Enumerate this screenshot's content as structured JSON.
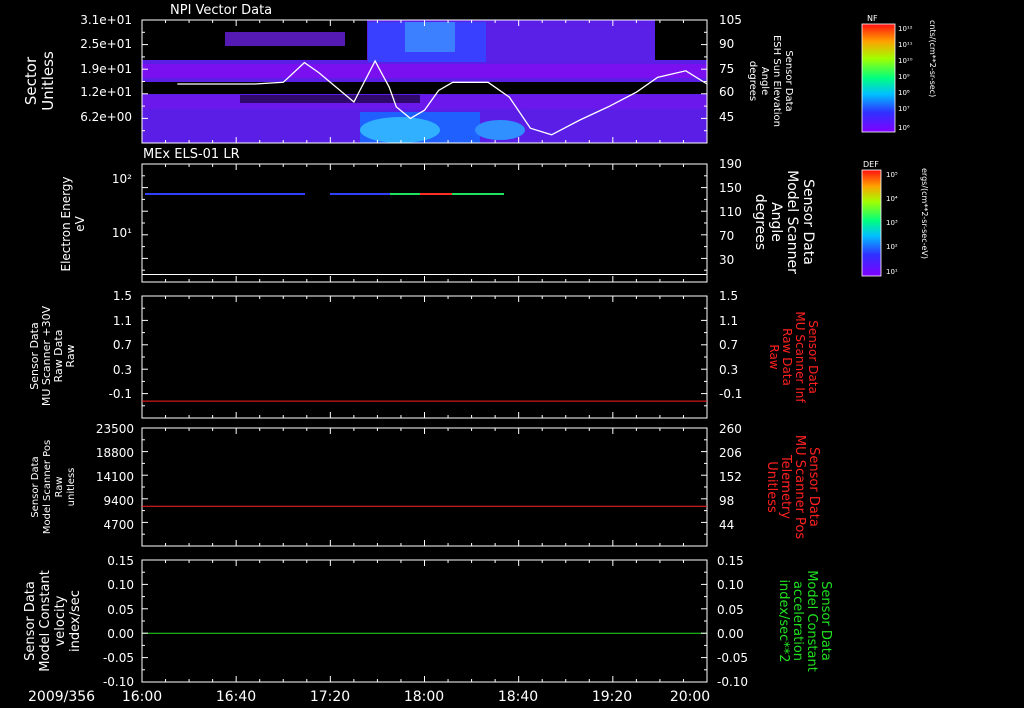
{
  "date_label": "2009/356",
  "time_ticks": [
    "16:00",
    "16:40",
    "17:20",
    "18:00",
    "18:40",
    "19:20",
    "20:00"
  ],
  "time_range_hours": [
    16,
    20
  ],
  "colors": {
    "white_trace": "#ffffff",
    "red_trace": "#ff2020",
    "green_trace": "#20e020",
    "axis": "#ffffff"
  },
  "chart_data": [
    {
      "type": "heatmap",
      "title": "NPI Vector Data",
      "ylabel_left": [
        "Sector",
        "Unitless"
      ],
      "left_ticks": [
        "3.1e+01",
        "2.5e+01",
        "1.9e+01",
        "1.2e+01",
        "6.2e+00"
      ],
      "right_ticks": [
        "105",
        "90",
        "75",
        "60",
        "45"
      ],
      "ylabel_right": [
        "Sensor Data",
        "ESH Sun Elevation",
        "Angle",
        "degrees"
      ],
      "right_range": [
        30,
        105
      ],
      "colorbar": {
        "label": "NF",
        "unit": "cnts/(cm**2-sr-sec)",
        "ticks": [
          "10¹²",
          "10¹¹",
          "10¹⁰",
          "10⁹",
          "10⁸",
          "10⁷",
          "10⁶"
        ]
      },
      "overlay_line": {
        "x": [
          16.25,
          16.8,
          17.0,
          17.15,
          17.25,
          17.5,
          17.65,
          17.75,
          17.8,
          17.9,
          18.0,
          18.1,
          18.2,
          18.3,
          18.45,
          18.6,
          18.75,
          18.9,
          19.1,
          19.3,
          19.5,
          19.65,
          19.85,
          20.0
        ],
        "y": [
          66,
          66,
          67,
          79,
          73,
          55,
          80,
          64,
          52,
          45,
          50,
          62,
          67,
          67,
          67,
          58,
          39,
          35,
          44,
          52,
          61,
          70,
          74,
          66
        ]
      }
    },
    {
      "type": "heatmap",
      "title": "MEx ELS-01 LR",
      "ylabel_left": [
        "Electron Energy",
        "eV"
      ],
      "left_ticks": [
        "10²",
        "10¹"
      ],
      "right_ticks": [
        "190",
        "150",
        "110",
        "70",
        "30"
      ],
      "ylabel_right": [
        "Sensor Data",
        "Model Scanner",
        "Angle",
        "degrees"
      ],
      "right_range": [
        0,
        190
      ],
      "colorbar": {
        "label": "DEF",
        "unit": "ergs/(cm**2-sr-sec-eV)",
        "ticks": [
          "10⁵",
          "10⁴",
          "10³",
          "10²",
          "10¹"
        ]
      },
      "overlay_line": {
        "x": [
          16.0,
          20.0
        ],
        "y": [
          12,
          12
        ]
      }
    },
    {
      "type": "line",
      "left_ticks": [
        "1.5",
        "1.1",
        "0.7",
        "0.3",
        "-0.1"
      ],
      "ylabel_left": [
        "Sensor Data",
        "MU Scanner +30V",
        "Raw Data",
        "Raw"
      ],
      "right_ticks": [
        "1.5",
        "1.1",
        "0.7",
        "0.3",
        "-0.1"
      ],
      "ylabel_right": [
        "Sensor Data",
        "MU Scanner Inf",
        "Raw Data",
        "Raw"
      ],
      "ylim": [
        -0.3,
        1.5
      ],
      "series": [
        {
          "x": [
            16.0,
            20.0
          ],
          "y": [
            -0.05,
            -0.05
          ]
        }
      ]
    },
    {
      "type": "line",
      "left_ticks": [
        "23500",
        "18800",
        "14100",
        "9400",
        "4700"
      ],
      "ylabel_left": [
        "Sensor Data",
        "Model Scanner Pos",
        "Raw",
        "unitless"
      ],
      "right_ticks": [
        "260",
        "206",
        "152",
        "98",
        "44"
      ],
      "ylabel_right": [
        "Sensor Data",
        "MU Scanner Pos",
        "Telemetry",
        "Unitless"
      ],
      "ylim": [
        0,
        23500
      ],
      "series": [
        {
          "x": [
            16.0,
            20.0
          ],
          "y": [
            7900,
            7900
          ]
        }
      ]
    },
    {
      "type": "line",
      "left_ticks": [
        "0.15",
        "0.10",
        "0.05",
        "0.00",
        "-0.05",
        "-0.10"
      ],
      "ylabel_left": [
        "Sensor Data",
        "Model Constant",
        "velocity",
        "index/sec"
      ],
      "right_ticks": [
        "0.15",
        "0.10",
        "0.05",
        "0.00",
        "-0.05",
        "-0.10"
      ],
      "ylabel_right": [
        "Sensor Data",
        "Model Constant",
        "acceleration",
        "index/sec**2"
      ],
      "ylim": [
        -0.1,
        0.15
      ],
      "series": [
        {
          "x": [
            16.0,
            20.0
          ],
          "y": [
            0.0,
            0.0
          ]
        }
      ]
    }
  ]
}
